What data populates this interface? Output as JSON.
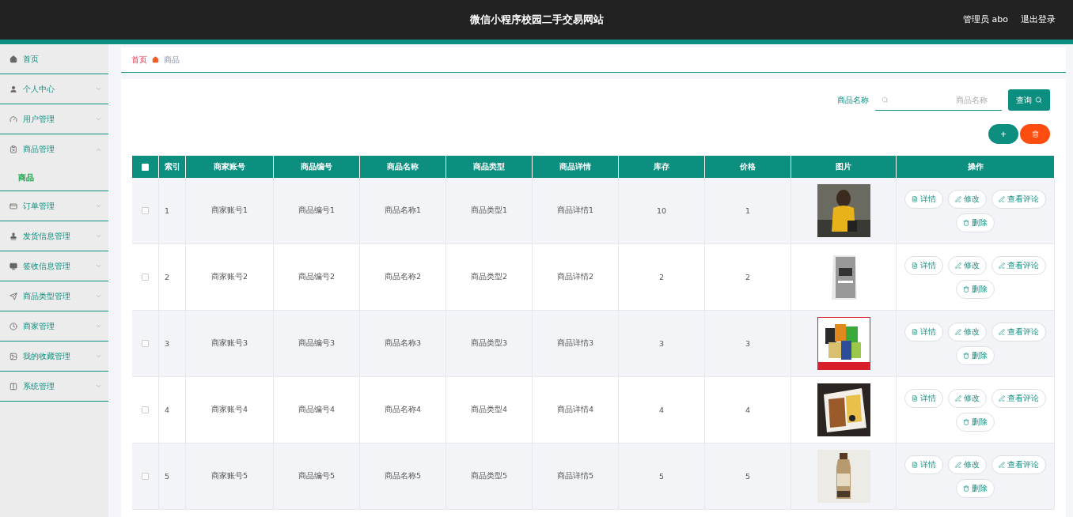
{
  "header": {
    "title": "微信小程序校园二手交易网站",
    "user": "管理员 abo",
    "logout": "退出登录"
  },
  "sidebar": {
    "items": [
      {
        "label": "首页",
        "expandable": false,
        "expanded": false
      },
      {
        "label": "个人中心",
        "expandable": true,
        "expanded": false
      },
      {
        "label": "用户管理",
        "expandable": true,
        "expanded": false
      },
      {
        "label": "商品管理",
        "expandable": true,
        "expanded": true,
        "children": [
          {
            "label": "商品",
            "selected": true
          }
        ]
      },
      {
        "label": "订单管理",
        "expandable": true,
        "expanded": false
      },
      {
        "label": "发货信息管理",
        "expandable": true,
        "expanded": false
      },
      {
        "label": "签收信息管理",
        "expandable": true,
        "expanded": false
      },
      {
        "label": "商品类型管理",
        "expandable": true,
        "expanded": false
      },
      {
        "label": "商家管理",
        "expandable": true,
        "expanded": false
      },
      {
        "label": "我的收藏管理",
        "expandable": true,
        "expanded": false
      },
      {
        "label": "系统管理",
        "expandable": true,
        "expanded": false
      }
    ]
  },
  "breadcrumb": [
    "首页",
    "商品"
  ],
  "search": {
    "label": "商品名称",
    "placeholder": "商品名称",
    "button": "查询"
  },
  "add_button": "+",
  "table": {
    "header_checked": false,
    "columns": [
      "索引",
      "商家账号",
      "商品编号",
      "商品名称",
      "商品类型",
      "商品详情",
      "库存",
      "价格",
      "图片",
      "操作"
    ],
    "rows": [
      {
        "checked": false,
        "cells": [
          "1",
          "商家账号1",
          "商品编号1",
          "商品名称1",
          "商品类型1",
          "商品详情1",
          "10",
          "1"
        ],
        "image": {
          "kind": "picture"
        },
        "actions": [
          "详情",
          "修改",
          "查看评论",
          "删除"
        ]
      },
      {
        "checked": false,
        "cells": [
          "2",
          "商家账号2",
          "商品编号2",
          "商品名称2",
          "商品类型2",
          "商品详情2",
          "2",
          "2"
        ],
        "image": {
          "kind": "picture"
        },
        "actions": [
          "详情",
          "修改",
          "查看评论",
          "删除"
        ]
      },
      {
        "checked": false,
        "cells": [
          "3",
          "商家账号3",
          "商品编号3",
          "商品名称3",
          "商品类型3",
          "商品详情3",
          "3",
          "3"
        ],
        "image": {
          "kind": "picture"
        },
        "actions": [
          "详情",
          "修改",
          "查看评论",
          "删除"
        ]
      },
      {
        "checked": false,
        "cells": [
          "4",
          "商家账号4",
          "商品编号4",
          "商品名称4",
          "商品类型4",
          "商品详情4",
          "4",
          "4"
        ],
        "image": {
          "kind": "picture"
        },
        "actions": [
          "详情",
          "修改",
          "查看评论",
          "删除"
        ]
      },
      {
        "checked": false,
        "cells": [
          "5",
          "商家账号5",
          "商品编号5",
          "商品名称5",
          "商品类型5",
          "商品详情5",
          "5",
          "5"
        ],
        "image": {
          "kind": "picture"
        },
        "actions": [
          "详情",
          "修改",
          "查看评论",
          "删除"
        ]
      }
    ]
  }
}
